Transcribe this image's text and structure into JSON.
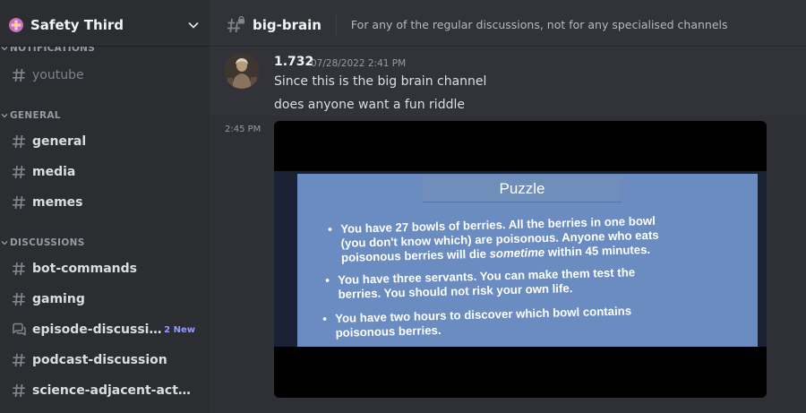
{
  "server": {
    "name": "Safety Third"
  },
  "sidebar": {
    "categories": {
      "notifications": "NOTIFICATIONS",
      "general": "GENERAL",
      "discussions": "DISCUSSIONS"
    },
    "channels": {
      "youtube": "youtube",
      "general": "general",
      "media": "media",
      "memes": "memes",
      "bot_commands": "bot-commands",
      "gaming": "gaming",
      "episode_discussion": "episode-discussion",
      "episode_discussion_badge": "2 New",
      "podcast_discussion": "podcast-discussion",
      "science_adjacent": "science-adjacent-activit..."
    }
  },
  "topbar": {
    "channel_name": "big-brain",
    "topic": "For any of the regular discussions, not for any specialised channels"
  },
  "message": {
    "author": "1.732",
    "timestamp": "07/28/2022 2:41 PM",
    "line1": "Since this is the big brain channel",
    "line2": "does anyone want a fun riddle",
    "followup_time": "2:45 PM"
  },
  "attachment": {
    "title": "Puzzle",
    "bullet1": {
      "l1": "You have 27 bowls of berries. All the berries in one bowl",
      "l2": "(you don't know which) are poisonous. Anyone who eats",
      "l3a": "poisonous berries will die ",
      "l3em": "sometime",
      "l3b": " within 45 minutes."
    },
    "bullet2": {
      "l1": "You have three servants. You can make them test the",
      "l2": "berries. You should not risk your own life."
    },
    "bullet3": {
      "l1": "You have two hours to discover which bowl contains",
      "l2": "poisonous berries."
    }
  },
  "colors": {
    "sidebar_bg": "#2b2d31",
    "chat_bg": "#313338",
    "new_badge": "#949cf7",
    "server_icon": "#c970b8"
  },
  "icons": {
    "channel": "hashtag-icon",
    "forum": "forum-bubble-icon",
    "locked_channel": "hashtag-lock-icon",
    "dropdown": "chevron-down-icon"
  }
}
